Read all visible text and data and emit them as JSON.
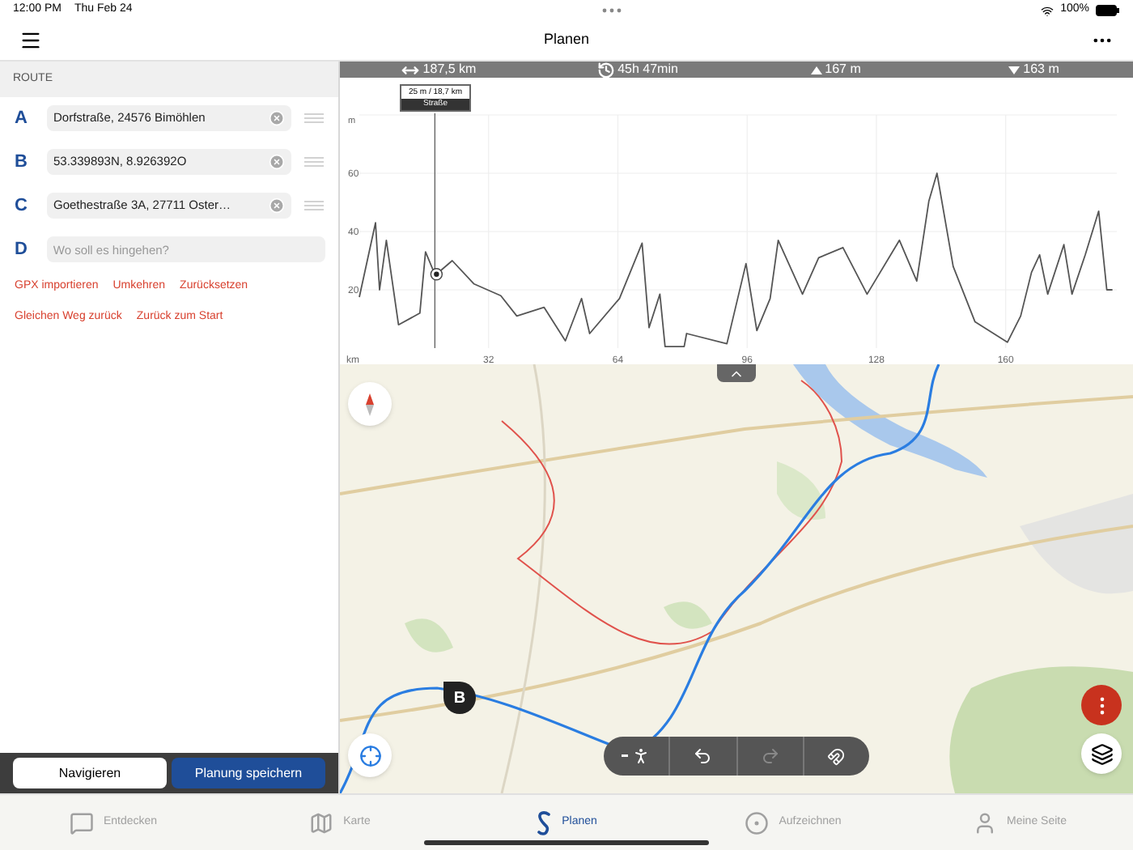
{
  "status_bar": {
    "time": "12:00 PM",
    "date": "Thu Feb 24",
    "battery": "100%"
  },
  "header": {
    "title": "Planen"
  },
  "route": {
    "heading": "ROUTE",
    "waypoints": [
      {
        "letter": "A",
        "value": "Dorfstraße, 24576 Bimöhlen"
      },
      {
        "letter": "B",
        "value": "53.339893N, 8.926392O"
      },
      {
        "letter": "C",
        "value": "Goethestraße 3A, 27711 Oster…"
      },
      {
        "letter": "D",
        "placeholder": "Wo soll es hingehen?"
      }
    ],
    "action_rows": [
      [
        "GPX importieren",
        "Umkehren",
        "Zurücksetzen"
      ],
      [
        "Gleichen Weg zurück",
        "Zurück zum Start"
      ]
    ]
  },
  "footer_buttons": [
    {
      "label": "Navigieren",
      "kind": "secondary"
    },
    {
      "label": "Planung speichern",
      "kind": "primary"
    }
  ],
  "stats": [
    {
      "kind": "distance",
      "value": "187,5 km"
    },
    {
      "kind": "duration",
      "value": "45h 47min"
    },
    {
      "kind": "ascent",
      "value": "167 m"
    },
    {
      "kind": "descent",
      "value": "163 m"
    }
  ],
  "elevation": {
    "chart_data": {
      "type": "line",
      "grid": true,
      "annotations": [
        "25 m / 18,7 km",
        "Straße"
      ],
      "ref_lines": [
        {
          "axis": "x",
          "value": 18.7
        }
      ],
      "xlabel": "km",
      "ylabel": "m",
      "xlim": [
        0,
        187.5
      ],
      "ylim": [
        0,
        80
      ],
      "xticks": [
        32,
        64,
        96,
        128,
        160
      ],
      "yticks": [
        20,
        40,
        60
      ],
      "x": [
        0,
        4,
        5,
        6.7,
        9.7,
        15,
        16.4,
        18.8,
        23,
        28.4,
        35,
        39,
        45.7,
        51,
        55,
        57,
        64.4,
        70,
        71.7,
        74.4,
        75.7,
        80.4,
        81,
        91,
        95.7,
        98.4,
        101.7,
        103.7,
        109.7,
        113.7,
        119.7,
        125.7,
        133.7,
        138,
        141,
        143,
        147,
        152.4,
        160.4,
        163.7,
        166.4,
        168.4,
        170.4,
        174.4,
        176.4,
        179.7,
        183,
        185,
        186.4
      ],
      "series": [
        {
          "color": "#555555",
          "values": [
            17.5,
            43,
            20,
            37,
            8,
            12,
            33,
            25,
            30,
            22,
            18,
            11,
            14,
            2.5,
            17,
            5,
            17,
            36,
            7,
            18.5,
            0.5,
            0.5,
            5,
            1.5,
            29,
            6,
            17,
            37,
            18.5,
            31,
            34.5,
            18.5,
            37,
            23,
            50.5,
            60,
            28,
            9,
            2,
            11,
            26,
            32,
            18.5,
            35.5,
            18.5,
            32,
            47,
            20,
            20
          ]
        }
      ]
    }
  },
  "map": {
    "marker": "B",
    "toolbar": [
      {
        "kind": "mode",
        "disabled": false
      },
      {
        "kind": "undo",
        "disabled": false
      },
      {
        "kind": "redo",
        "disabled": true
      },
      {
        "kind": "snap",
        "disabled": false
      }
    ]
  },
  "tabs": [
    {
      "label": "Entdecken",
      "kind": "discover",
      "selected": false
    },
    {
      "label": "Karte",
      "kind": "map",
      "selected": false
    },
    {
      "label": "Planen",
      "kind": "plan",
      "selected": true
    },
    {
      "label": "Aufzeichnen",
      "kind": "record",
      "selected": false
    },
    {
      "label": "Meine Seite",
      "kind": "profile",
      "selected": false
    }
  ]
}
